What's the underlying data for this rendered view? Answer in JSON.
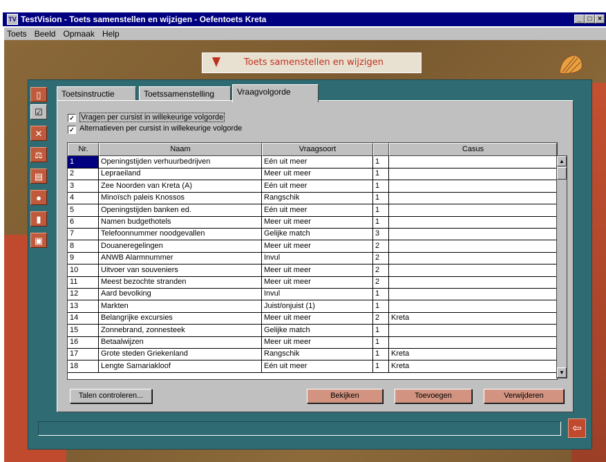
{
  "window": {
    "title": "TestVision - Toets samenstellen en wijzigen - Oefentoets Kreta",
    "app_icon": "app-icon",
    "controls": [
      "minimize-icon",
      "maximize-icon",
      "close-icon"
    ]
  },
  "menu": {
    "items": [
      "Toets",
      "Beeld",
      "Opmaak",
      "Help"
    ]
  },
  "header": {
    "title": "Toets samenstellen en wijzigen"
  },
  "sidebar": {
    "icons": [
      "document-icon",
      "checklist-icon",
      "tools-icon",
      "scales-icon",
      "printer-icon",
      "traffic-light-icon",
      "thermometer-icon",
      "save-icon"
    ]
  },
  "tabs": [
    {
      "label": "Toetsinstructie"
    },
    {
      "label": "Toetssamenstelling"
    },
    {
      "label": "Vraagvolgorde"
    }
  ],
  "active_tab": "Vraagvolgorde",
  "options": {
    "random_questions": {
      "label": "Vragen per cursist in willekeurige volgorde",
      "checked": true
    },
    "random_alternatives": {
      "label": "Alternatieven per cursist in willekeurige volgorde",
      "checked": true
    }
  },
  "table": {
    "columns": [
      "Nr.",
      "Naam",
      "Vraagsoort",
      "",
      "Casus"
    ],
    "rows": [
      {
        "nr": "1",
        "naam": "Openingstijden verhuurbedrijven",
        "vraagsoort": "Eén uit meer",
        "score": "1",
        "casus": ""
      },
      {
        "nr": "2",
        "naam": "Lepraeiland",
        "vraagsoort": "Meer uit meer",
        "score": "1",
        "casus": ""
      },
      {
        "nr": "3",
        "naam": "Zee Noorden van Kreta (A)",
        "vraagsoort": "Eén uit meer",
        "score": "1",
        "casus": ""
      },
      {
        "nr": "4",
        "naam": "Minoïsch paleis Knossos",
        "vraagsoort": "Rangschik",
        "score": "1",
        "casus": ""
      },
      {
        "nr": "5",
        "naam": "Openingstijden banken ed.",
        "vraagsoort": "Eén uit meer",
        "score": "1",
        "casus": ""
      },
      {
        "nr": "6",
        "naam": "Namen budgethotels",
        "vraagsoort": "Meer uit meer",
        "score": "1",
        "casus": ""
      },
      {
        "nr": "7",
        "naam": "Telefoonnummer noodgevallen",
        "vraagsoort": "Gelijke match",
        "score": "3",
        "casus": ""
      },
      {
        "nr": "8",
        "naam": "Douaneregelingen",
        "vraagsoort": "Meer uit meer",
        "score": "2",
        "casus": ""
      },
      {
        "nr": "9",
        "naam": "ANWB Alarmnummer",
        "vraagsoort": "Invul",
        "score": "2",
        "casus": ""
      },
      {
        "nr": "10",
        "naam": "Uitvoer van souveniers",
        "vraagsoort": "Meer uit meer",
        "score": "2",
        "casus": ""
      },
      {
        "nr": "11",
        "naam": "Meest bezochte stranden",
        "vraagsoort": "Meer uit meer",
        "score": "2",
        "casus": ""
      },
      {
        "nr": "12",
        "naam": "Aard bevolking",
        "vraagsoort": "Invul",
        "score": "1",
        "casus": ""
      },
      {
        "nr": "13",
        "naam": "Markten",
        "vraagsoort": "Juist/onjuist (1)",
        "score": "1",
        "casus": ""
      },
      {
        "nr": "14",
        "naam": "Belangrijke excursies",
        "vraagsoort": "Meer uit meer",
        "score": "2",
        "casus": "Kreta"
      },
      {
        "nr": "15",
        "naam": "Zonnebrand, zonnesteek",
        "vraagsoort": "Gelijke match",
        "score": "1",
        "casus": ""
      },
      {
        "nr": "16",
        "naam": "Betaalwijzen",
        "vraagsoort": "Meer uit meer",
        "score": "1",
        "casus": ""
      },
      {
        "nr": "17",
        "naam": "Grote steden Griekenland",
        "vraagsoort": "Rangschik",
        "score": "1",
        "casus": "Kreta"
      },
      {
        "nr": "18",
        "naam": "Lengte Samariakloof",
        "vraagsoort": "Eén uit meer",
        "score": "1",
        "casus": "Kreta"
      }
    ]
  },
  "buttons": {
    "talen": "Talen controleren...",
    "bekijken": "Bekijken",
    "toevoegen": "Toevoegen",
    "verwijderen": "Verwijderen"
  },
  "colors": {
    "accent": "#c03020",
    "frame": "#2f6b72",
    "button": "#d29480"
  }
}
